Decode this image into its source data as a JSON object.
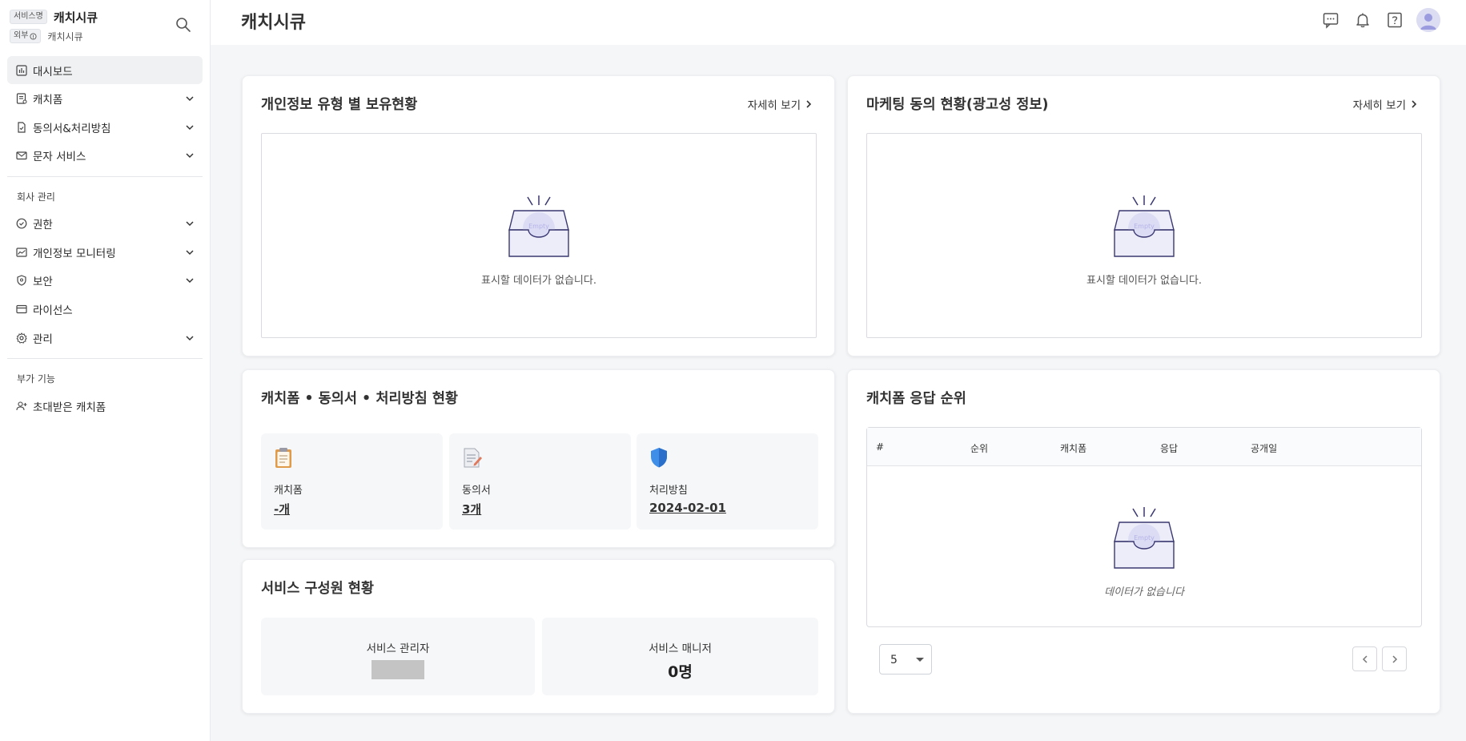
{
  "brand": {
    "service_tag": "서비스명",
    "service_name": "캐치시큐",
    "external_tag": "외부",
    "sub_name": "캐치시큐"
  },
  "sidebar": {
    "items": [
      {
        "label": "대시보드",
        "icon": "dashboard-icon",
        "active": true,
        "expandable": false
      },
      {
        "label": "캐치폼",
        "icon": "form-icon",
        "expandable": true
      },
      {
        "label": "동의서&처리방침",
        "icon": "document-icon",
        "expandable": true
      },
      {
        "label": "문자 서비스",
        "icon": "mail-icon",
        "expandable": true
      }
    ],
    "group_company": "회사 관리",
    "company_items": [
      {
        "label": "권한",
        "icon": "check-circle-icon",
        "expandable": true
      },
      {
        "label": "개인정보 모니터링",
        "icon": "chart-icon",
        "expandable": true
      },
      {
        "label": "보안",
        "icon": "shield-icon",
        "expandable": true
      },
      {
        "label": "라이선스",
        "icon": "card-icon",
        "expandable": false
      },
      {
        "label": "관리",
        "icon": "settings-icon",
        "expandable": true
      }
    ],
    "group_extra": "부가 기능",
    "extra_items": [
      {
        "label": "초대받은 캐치폼",
        "icon": "user-add-icon",
        "expandable": false
      }
    ]
  },
  "header": {
    "title": "캐치시큐",
    "icons": [
      "chat-icon",
      "bell-icon",
      "help-icon",
      "avatar"
    ]
  },
  "cards": {
    "privacy": {
      "title": "개인정보 유형 별 보유현황",
      "detail_link": "자세히 보기",
      "empty_text": "표시할 데이터가 없습니다."
    },
    "marketing": {
      "title": "마케팅 동의 현황(광고성 정보)",
      "detail_link": "자세히 보기",
      "empty_text": "표시할 데이터가 없습니다."
    },
    "status": {
      "title": "캐치폼 • 동의서 • 처리방침 현황",
      "tiles": [
        {
          "label": "캐치폼",
          "value": "-개",
          "icon": "clipboard-icon"
        },
        {
          "label": "동의서",
          "value": "3개",
          "icon": "document-pen-icon"
        },
        {
          "label": "처리방침",
          "value": "2024-02-01",
          "icon": "shield-icon"
        }
      ]
    },
    "members": {
      "title": "서비스 구성원 현황",
      "admin_label": "서비스 관리자",
      "manager_label": "서비스 매니저",
      "manager_value": "0명"
    },
    "ranking": {
      "title": "캐치폼 응답 순위",
      "columns": [
        "#",
        "순위",
        "캐치폼",
        "응답",
        "공개일"
      ],
      "empty_text": "데이터가 없습니다",
      "page_size": "5"
    }
  },
  "empty_illustration_text": "Empty",
  "colors": {
    "accent": "#6c63c9",
    "illustration_fill": "#ededfa",
    "illustration_stroke": "#3a3870"
  }
}
